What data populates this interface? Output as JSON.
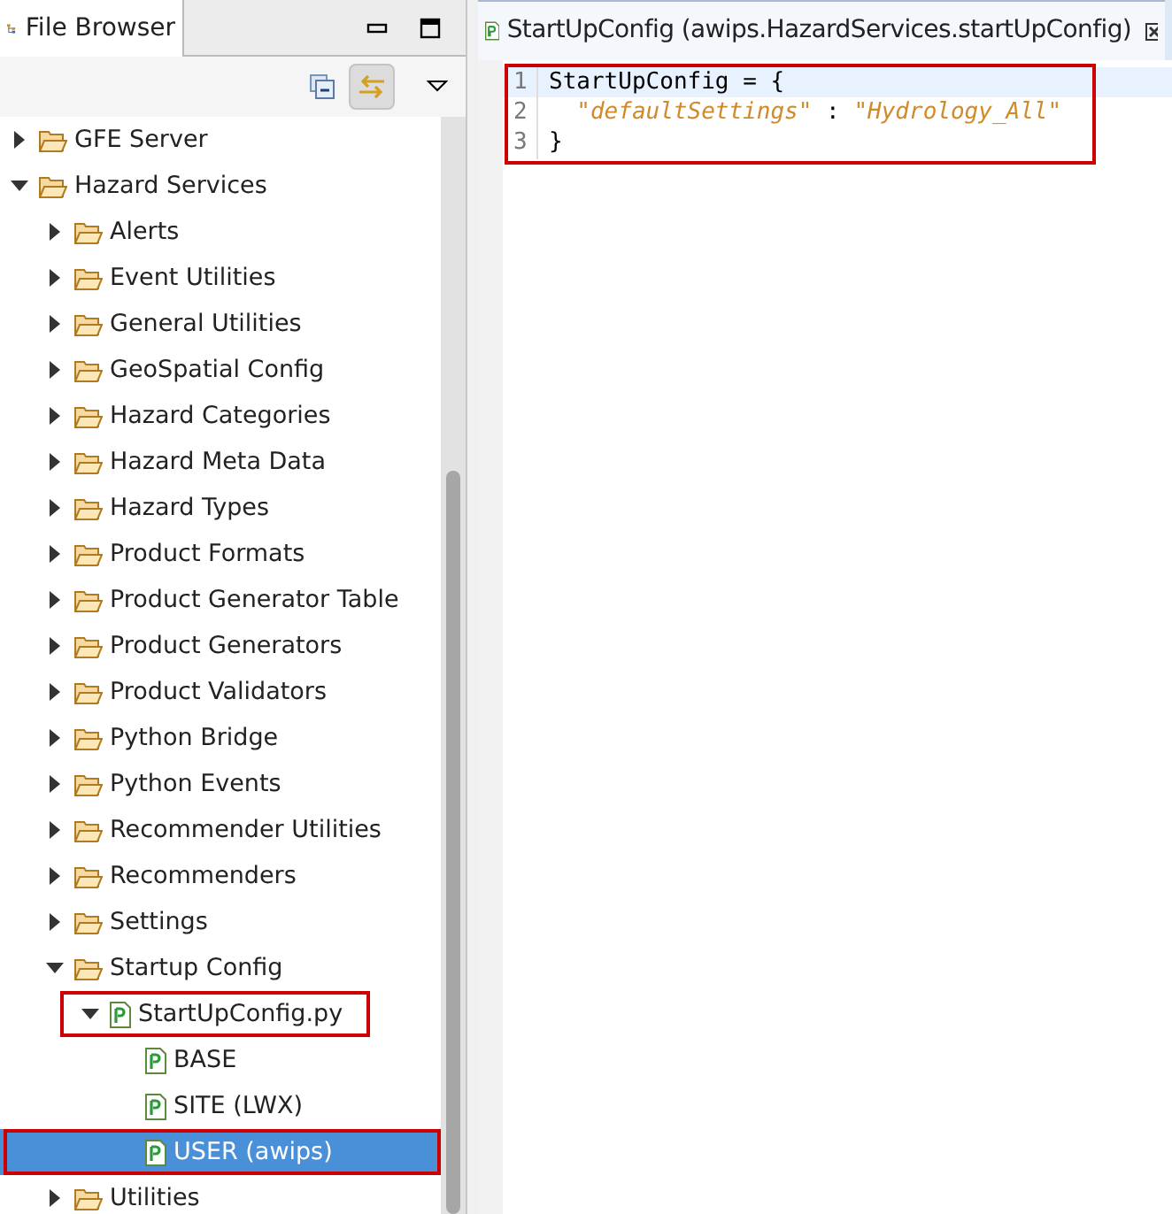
{
  "browser_panel": {
    "title": "File Browser"
  },
  "tree": [
    {
      "label": "GFE Server",
      "kind": "folder",
      "expanded": false,
      "selected": false,
      "highlighted": false
    },
    {
      "label": "Hazard Services",
      "kind": "folder",
      "expanded": true,
      "selected": false,
      "highlighted": false,
      "children": [
        {
          "label": "Alerts",
          "kind": "folder",
          "expanded": false,
          "selected": false,
          "highlighted": false
        },
        {
          "label": "Event Utilities",
          "kind": "folder",
          "expanded": false,
          "selected": false,
          "highlighted": false
        },
        {
          "label": "General Utilities",
          "kind": "folder",
          "expanded": false,
          "selected": false,
          "highlighted": false
        },
        {
          "label": "GeoSpatial Config",
          "kind": "folder",
          "expanded": false,
          "selected": false,
          "highlighted": false
        },
        {
          "label": "Hazard Categories",
          "kind": "folder",
          "expanded": false,
          "selected": false,
          "highlighted": false
        },
        {
          "label": "Hazard Meta Data",
          "kind": "folder",
          "expanded": false,
          "selected": false,
          "highlighted": false
        },
        {
          "label": "Hazard Types",
          "kind": "folder",
          "expanded": false,
          "selected": false,
          "highlighted": false
        },
        {
          "label": "Product Formats",
          "kind": "folder",
          "expanded": false,
          "selected": false,
          "highlighted": false
        },
        {
          "label": "Product Generator Table",
          "kind": "folder",
          "expanded": false,
          "selected": false,
          "highlighted": false
        },
        {
          "label": "Product Generators",
          "kind": "folder",
          "expanded": false,
          "selected": false,
          "highlighted": false
        },
        {
          "label": "Product Validators",
          "kind": "folder",
          "expanded": false,
          "selected": false,
          "highlighted": false
        },
        {
          "label": "Python Bridge",
          "kind": "folder",
          "expanded": false,
          "selected": false,
          "highlighted": false
        },
        {
          "label": "Python Events",
          "kind": "folder",
          "expanded": false,
          "selected": false,
          "highlighted": false
        },
        {
          "label": "Recommender Utilities",
          "kind": "folder",
          "expanded": false,
          "selected": false,
          "highlighted": false
        },
        {
          "label": "Recommenders",
          "kind": "folder",
          "expanded": false,
          "selected": false,
          "highlighted": false
        },
        {
          "label": "Settings",
          "kind": "folder",
          "expanded": false,
          "selected": false,
          "highlighted": false
        },
        {
          "label": "Startup Config",
          "kind": "folder",
          "expanded": true,
          "selected": false,
          "highlighted": false,
          "children": [
            {
              "label": "StartUpConfig.py",
              "kind": "file",
              "expanded": true,
              "selected": false,
              "highlighted": true,
              "children": [
                {
                  "label": "BASE",
                  "kind": "leaf",
                  "selected": false,
                  "highlighted": false
                },
                {
                  "label": "SITE (LWX)",
                  "kind": "leaf",
                  "selected": false,
                  "highlighted": false
                },
                {
                  "label": "USER (awips)",
                  "kind": "leaf",
                  "selected": true,
                  "highlighted": true
                }
              ]
            }
          ]
        },
        {
          "label": "Utilities",
          "kind": "folder",
          "expanded": false,
          "selected": false,
          "highlighted": false
        }
      ]
    }
  ],
  "editor": {
    "tab_title": "StartUpConfig (awips.HazardServices.startUpConfig)",
    "highlighted": true,
    "lines": [
      {
        "number": "1",
        "indented": false,
        "tokens": [
          {
            "kind": "plain",
            "text": "StartUpConfig = {"
          }
        ]
      },
      {
        "number": "2",
        "indented": true,
        "tokens": [
          {
            "kind": "string",
            "text": "\"defaultSettings\""
          },
          {
            "kind": "plain",
            "text": " : "
          },
          {
            "kind": "string",
            "text": "\"Hydrology_All\""
          }
        ]
      },
      {
        "number": "3",
        "indented": false,
        "tokens": [
          {
            "kind": "plain",
            "text": "}"
          }
        ]
      }
    ]
  }
}
